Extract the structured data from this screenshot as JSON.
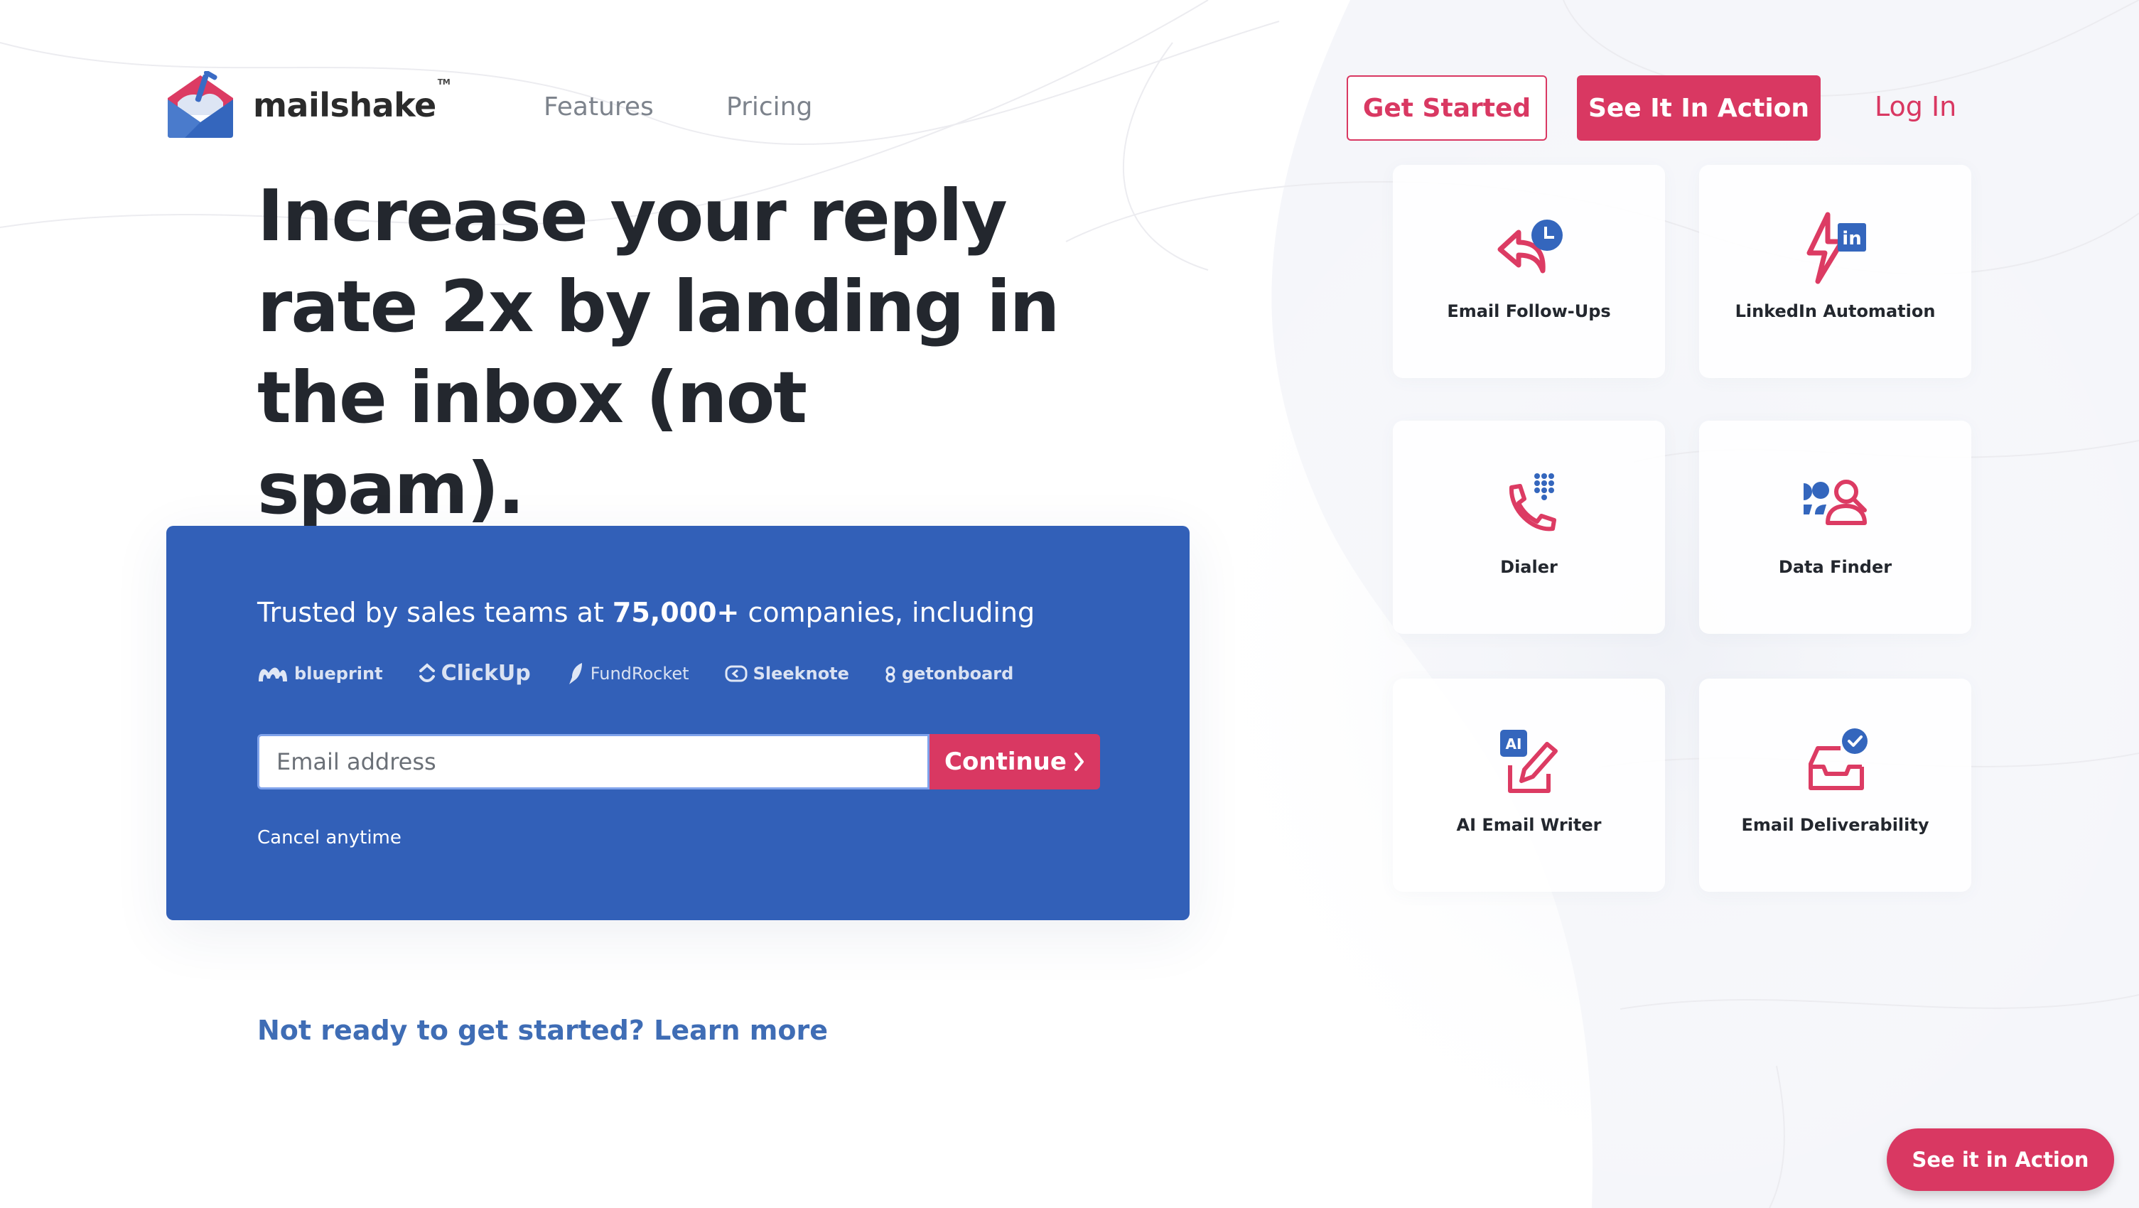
{
  "brand": {
    "name": "mailshake",
    "trademark": "TM",
    "accent": "#d93862",
    "blue": "#3260b8"
  },
  "nav": {
    "links": [
      {
        "label": "Features"
      },
      {
        "label": "Pricing"
      }
    ],
    "get_started": "Get Started",
    "see_in_action": "See It In Action",
    "login": "Log In"
  },
  "hero": {
    "headline_lines": [
      "Increase your reply",
      "rate 2x by landing in",
      "the inbox (not spam)."
    ]
  },
  "signup": {
    "trusted_prefix": "Trusted by sales teams at ",
    "trusted_count": "75,000+",
    "trusted_suffix": " companies, including",
    "company_logos": [
      {
        "name": "blueprint",
        "icon": "blueprint-logo-icon"
      },
      {
        "name": "ClickUp",
        "icon": "clickup-logo-icon"
      },
      {
        "name": "FundRocket",
        "icon": "rocket-icon"
      },
      {
        "name": "Sleeknote",
        "icon": "sleeknote-logo-icon"
      },
      {
        "name": "getonboard",
        "icon": "getonboard-logo-icon"
      }
    ],
    "email_placeholder": "Email address",
    "email_value": "",
    "continue_label": "Continue",
    "continue_icon": "chevron-right-icon",
    "cancel_text": "Cancel anytime"
  },
  "learn_more": "Not ready to get started? Learn more",
  "features": [
    {
      "label": "Email Follow-Ups",
      "icon": "reply-clock-icon"
    },
    {
      "label": "LinkedIn Automation",
      "icon": "lightning-linkedin-icon"
    },
    {
      "label": "Dialer",
      "icon": "phone-keypad-icon"
    },
    {
      "label": "Data Finder",
      "icon": "people-search-icon"
    },
    {
      "label": "AI Email Writer",
      "icon": "ai-pencil-icon"
    },
    {
      "label": "Email Deliverability",
      "icon": "inbox-check-icon"
    }
  ],
  "floating_cta": "See it in Action"
}
